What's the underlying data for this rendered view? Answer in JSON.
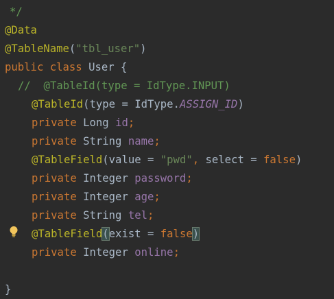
{
  "code_lines": [
    {
      "tokens": [
        {
          "t": "*/",
          "c": "cmt"
        }
      ]
    },
    {
      "tokens": [
        {
          "t": "@Data",
          "c": "ann"
        }
      ]
    },
    {
      "tokens": [
        {
          "t": "@TableName",
          "c": "ann"
        },
        {
          "t": "(",
          "c": "plain"
        },
        {
          "t": "\"tbl_user\"",
          "c": "str"
        },
        {
          "t": ")",
          "c": "plain"
        }
      ]
    },
    {
      "tokens": [
        {
          "t": "public ",
          "c": "kw"
        },
        {
          "t": "class ",
          "c": "kw"
        },
        {
          "t": "User {",
          "c": "plain"
        }
      ]
    },
    {
      "tokens": [
        {
          "t": "//  @TableId(type = IdType.INPUT)",
          "c": "cmt"
        }
      ]
    },
    {
      "tokens": [
        {
          "t": "@TableId",
          "c": "ann"
        },
        {
          "t": "(type = IdType.",
          "c": "plain"
        },
        {
          "t": "ASSIGN_ID",
          "c": "italic-field"
        },
        {
          "t": ")",
          "c": "plain"
        }
      ]
    },
    {
      "tokens": [
        {
          "t": "private ",
          "c": "kw"
        },
        {
          "t": "Long ",
          "c": "plain"
        },
        {
          "t": "id",
          "c": "field"
        },
        {
          "t": ";",
          "c": "kw"
        }
      ]
    },
    {
      "tokens": [
        {
          "t": "private ",
          "c": "kw"
        },
        {
          "t": "String ",
          "c": "plain"
        },
        {
          "t": "name",
          "c": "field"
        },
        {
          "t": ";",
          "c": "kw"
        }
      ]
    },
    {
      "tokens": [
        {
          "t": "@TableField",
          "c": "ann"
        },
        {
          "t": "(value = ",
          "c": "plain"
        },
        {
          "t": "\"pwd\"",
          "c": "str"
        },
        {
          "t": ", ",
          "c": "kw"
        },
        {
          "t": "select = ",
          "c": "plain"
        },
        {
          "t": "false",
          "c": "kw"
        },
        {
          "t": ")",
          "c": "plain"
        }
      ]
    },
    {
      "tokens": [
        {
          "t": "private ",
          "c": "kw"
        },
        {
          "t": "Integer ",
          "c": "plain"
        },
        {
          "t": "password",
          "c": "field"
        },
        {
          "t": ";",
          "c": "kw"
        }
      ]
    },
    {
      "tokens": [
        {
          "t": "private ",
          "c": "kw"
        },
        {
          "t": "Integer ",
          "c": "plain"
        },
        {
          "t": "age",
          "c": "field"
        },
        {
          "t": ";",
          "c": "kw"
        }
      ]
    },
    {
      "tokens": [
        {
          "t": "private ",
          "c": "kw"
        },
        {
          "t": "String ",
          "c": "plain"
        },
        {
          "t": "tel",
          "c": "field"
        },
        {
          "t": ";",
          "c": "kw"
        }
      ]
    },
    {
      "tokens": [
        {
          "t": "@TableField",
          "c": "ann"
        },
        {
          "t": "(",
          "c": "paren-hl"
        },
        {
          "t": "exist = ",
          "c": "plain"
        },
        {
          "t": "false",
          "c": "kw"
        },
        {
          "t": ")",
          "c": "paren-hl"
        }
      ]
    },
    {
      "tokens": [
        {
          "t": "private ",
          "c": "kw"
        },
        {
          "t": "Integer ",
          "c": "plain"
        },
        {
          "t": "online",
          "c": "field"
        },
        {
          "t": ";",
          "c": "kw"
        }
      ]
    },
    {
      "tokens": []
    },
    {
      "tokens": [
        {
          "t": "}",
          "c": "plain"
        }
      ]
    }
  ],
  "gutter_icon": "lightbulb-icon",
  "colors": {
    "background": "#2b2b2b",
    "keyword": "#cc7832",
    "annotation": "#bbb529",
    "string": "#6a8759",
    "field": "#9876aa",
    "comment": "#629755",
    "text": "#a9b7c6"
  }
}
